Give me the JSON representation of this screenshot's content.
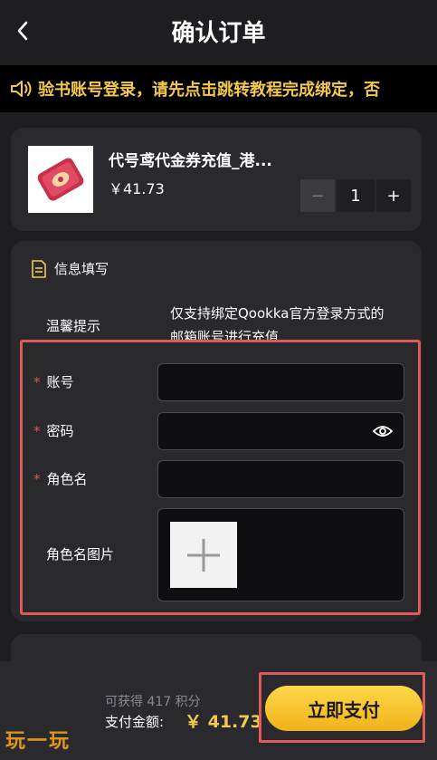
{
  "header": {
    "title": "确认订单"
  },
  "notice": {
    "text": "验书账号登录，请先点击跳转教程完成绑定，否"
  },
  "product": {
    "name": "代号鸢代金券充值_港...",
    "price": "￥41.73",
    "quantity": "1",
    "minus": "−",
    "plus": "+"
  },
  "info": {
    "section_title": "信息填写",
    "tip_label": "温馨提示",
    "tip_text": "仅支持绑定Qookka官方登录方式的邮箱账号进行充值",
    "fields": {
      "account_label": "账号",
      "password_label": "密码",
      "role_label": "角色名",
      "role_image_label": "角色名图片",
      "required_mark": "*"
    }
  },
  "footer": {
    "points_text": "可获得 417 积分",
    "pay_label": "支付金额:",
    "pay_amount": "￥ 41.73",
    "pay_button": "立即支付"
  },
  "watermark": {
    "text": "玩一玩"
  },
  "colors": {
    "background": "#1e1e20",
    "card": "#2a2a2e",
    "accent": "#f2c94c",
    "highlight": "#e05a5a",
    "required": "#e05454"
  },
  "icons": {
    "back": "chevron-left-icon",
    "notice": "speaker-icon",
    "section": "document-icon",
    "password_toggle": "eye-icon",
    "upload": "plus-icon"
  }
}
